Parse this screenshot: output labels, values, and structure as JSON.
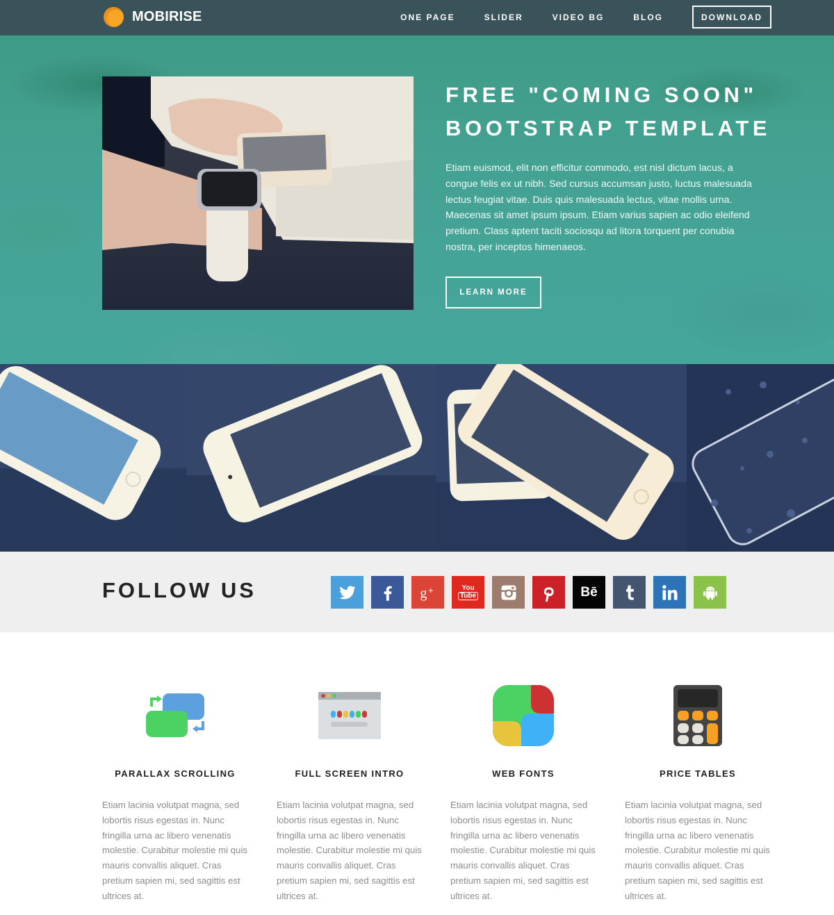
{
  "navbar": {
    "brand": "MOBIRISE",
    "links": [
      "ONE PAGE",
      "SLIDER",
      "VIDEO BG",
      "BLOG"
    ],
    "download": "DOWNLOAD"
  },
  "hero": {
    "title_line1": "FREE \"COMING SOON\"",
    "title_line2": "BOOTSTRAP TEMPLATE",
    "body": "Etiam euismod, elit non efficitur commodo, est nisl dictum lacus, a congue felis ex ut nibh. Sed cursus accumsan justo, luctus malesuada lectus feugiat vitae. Duis quis malesuada lectus, vitae mollis urna. Maecenas sit amet ipsum ipsum. Etiam varius sapien ac odio eleifend pretium. Class aptent taciti sociosqu ad litora torquent per conubia nostra, per inceptos himenaeos.",
    "button": "LEARN MORE",
    "image": "smartwatch-and-phone-photo"
  },
  "gallery": {
    "images": [
      "white-phone-water-drops-1",
      "white-phone-water-drops-2",
      "two-phones-water-drops",
      "phone-screen-water-drops"
    ]
  },
  "follow": {
    "title": "FOLLOW US",
    "networks": [
      {
        "name": "twitter",
        "color": "#4ba0db"
      },
      {
        "name": "facebook",
        "color": "#3b5999"
      },
      {
        "name": "google-plus",
        "color": "#db4437"
      },
      {
        "name": "youtube",
        "color": "#e1281f"
      },
      {
        "name": "instagram",
        "color": "#9d7b6d"
      },
      {
        "name": "pinterest",
        "color": "#cc2127"
      },
      {
        "name": "behance",
        "color": "#050505"
      },
      {
        "name": "tumblr",
        "color": "#44566f"
      },
      {
        "name": "linkedin",
        "color": "#2e73b8"
      },
      {
        "name": "android",
        "color": "#8bc24a"
      }
    ],
    "youtube_text_top": "You",
    "youtube_text_bottom": "Tube",
    "behance_text": "Bē"
  },
  "features": [
    {
      "title": "PARALLAX SCROLLING",
      "icon": "parallax-icon",
      "body": "Etiam lacinia volutpat magna, sed lobortis risus egestas in. Nunc fringilla urna ac libero venenatis molestie. Curabitur molestie mi quis mauris convallis aliquet. Cras pretium sapien mi, sed sagittis est ultrices at."
    },
    {
      "title": "FULL SCREEN INTRO",
      "icon": "browser-window-icon",
      "body": "Etiam lacinia volutpat magna, sed lobortis risus egestas in. Nunc fringilla urna ac libero venenatis molestie. Curabitur molestie mi quis mauris convallis aliquet. Cras pretium sapien mi, sed sagittis est ultrices at."
    },
    {
      "title": "WEB FONTS",
      "icon": "web-fonts-icon",
      "body": "Etiam lacinia volutpat magna, sed lobortis risus egestas in. Nunc fringilla urna ac libero venenatis molestie. Curabitur molestie mi quis mauris convallis aliquet. Cras pretium sapien mi, sed sagittis est ultrices at."
    },
    {
      "title": "PRICE TABLES",
      "icon": "calculator-icon",
      "body": "Etiam lacinia volutpat magna, sed lobortis risus egestas in. Nunc fringilla urna ac libero venenatis molestie. Curabitur molestie mi quis mauris convallis aliquet. Cras pretium sapien mi, sed sagittis est ultrices at."
    }
  ],
  "colors": {
    "navbar": "#3a525a",
    "hero_teal": "#45a69c",
    "brand_orange": "#f8a424",
    "follow_bg": "#efefef"
  }
}
